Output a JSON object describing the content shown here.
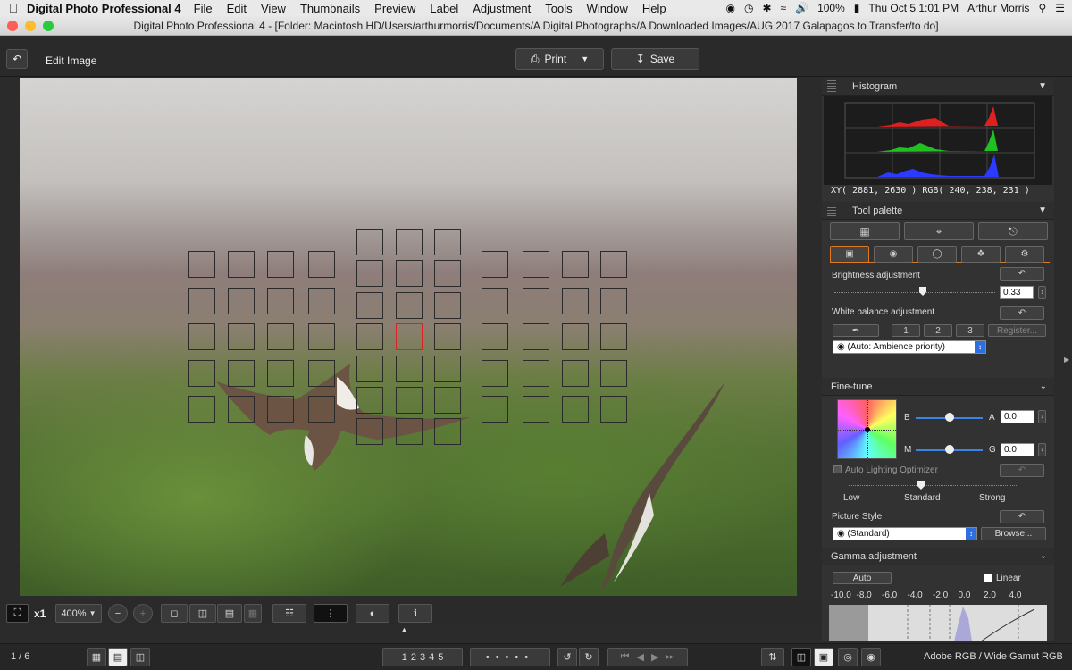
{
  "menubar": {
    "app": "Digital Photo Professional 4",
    "items": [
      "File",
      "Edit",
      "View",
      "Thumbnails",
      "Preview",
      "Label",
      "Adjustment",
      "Tools",
      "Window",
      "Help"
    ],
    "battery": "100%",
    "clock": "Thu Oct 5  1:01 PM",
    "user": "Arthur Morris"
  },
  "window": {
    "title": "Digital Photo Professional 4 - [Folder: Macintosh HD/Users/arthurmorris/Documents/A Digital Photographs/A Downloaded Images/AUG 2017 Galapagos to Transfer/to do]"
  },
  "toolbar": {
    "mode": "Edit Image",
    "print": "Print",
    "save": "Save"
  },
  "histogram": {
    "title": "Histogram",
    "readout": "XY(  2881,  2630 ) RGB( 240, 238, 231 )"
  },
  "tool_palette": {
    "title": "Tool palette",
    "brightness_label": "Brightness adjustment",
    "brightness_value": "0.33",
    "brightness_level": 0.55,
    "wb_label": "White balance adjustment",
    "wb_buttons": [
      "1",
      "2",
      "3"
    ],
    "register": "Register...",
    "wb_mode": "(Auto: Ambience priority)"
  },
  "finetune": {
    "title": "Fine-tune",
    "b_label": "B",
    "a_label": "A",
    "a_value": "0.0",
    "m_label": "M",
    "g_label": "G",
    "g_value": "0.0",
    "alo": "Auto Lighting Optimizer",
    "low": "Low",
    "standard": "Standard",
    "strong": "Strong",
    "ps_label": "Picture Style",
    "ps_value": "(Standard)",
    "browse": "Browse..."
  },
  "gamma": {
    "title": "Gamma adjustment",
    "auto": "Auto",
    "linear": "Linear",
    "scale": [
      "-10.0",
      "-8.0",
      "-6.0",
      "-4.0",
      "-2.0",
      "0.0",
      "2.0",
      "4.0"
    ]
  },
  "zoom": {
    "x1": "x1",
    "level": "400%"
  },
  "status": {
    "page": "1 / 6",
    "ratings": [
      "1",
      "2",
      "3",
      "4",
      "5"
    ],
    "colorspace": "Adobe RGB / Wide Gamut RGB"
  }
}
